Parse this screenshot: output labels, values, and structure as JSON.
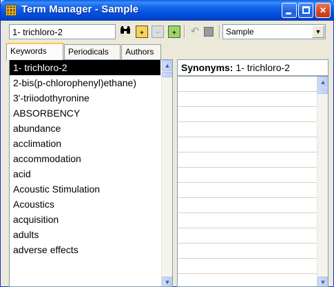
{
  "window": {
    "title": "Term Manager - Sample",
    "controls": {
      "minimize": "_",
      "maximize": "□",
      "close": "✕"
    }
  },
  "toolbar": {
    "term_input_value": "1- trichloro-2",
    "find_icon": "binoculars-icon",
    "icons": [
      "binoculars-icon",
      "add-term-icon",
      "delete-term-icon",
      "add-synonym-icon",
      "undo-icon",
      "save-icon"
    ],
    "database_select_value": "Sample"
  },
  "tabs": [
    {
      "label": "Keywords",
      "active": true
    },
    {
      "label": "Periodicals",
      "active": false
    },
    {
      "label": "Authors",
      "active": false
    }
  ],
  "keywords": {
    "selected_index": 0,
    "items": [
      "1- trichloro-2",
      "2-bis(p-chlorophenyl)ethane)",
      "3'-triiodothyronine",
      "ABSORBENCY",
      "abundance",
      "acclimation",
      "accommodation",
      "acid",
      "Acoustic Stimulation",
      "Acoustics",
      "acquisition",
      "adults",
      "adverse effects"
    ]
  },
  "synonyms": {
    "label": "Synonyms:",
    "term": "1- trichloro-2"
  },
  "colors": {
    "titlebar": "#0553E0",
    "selection": "#000000",
    "window_bg": "#ECE9D8"
  }
}
